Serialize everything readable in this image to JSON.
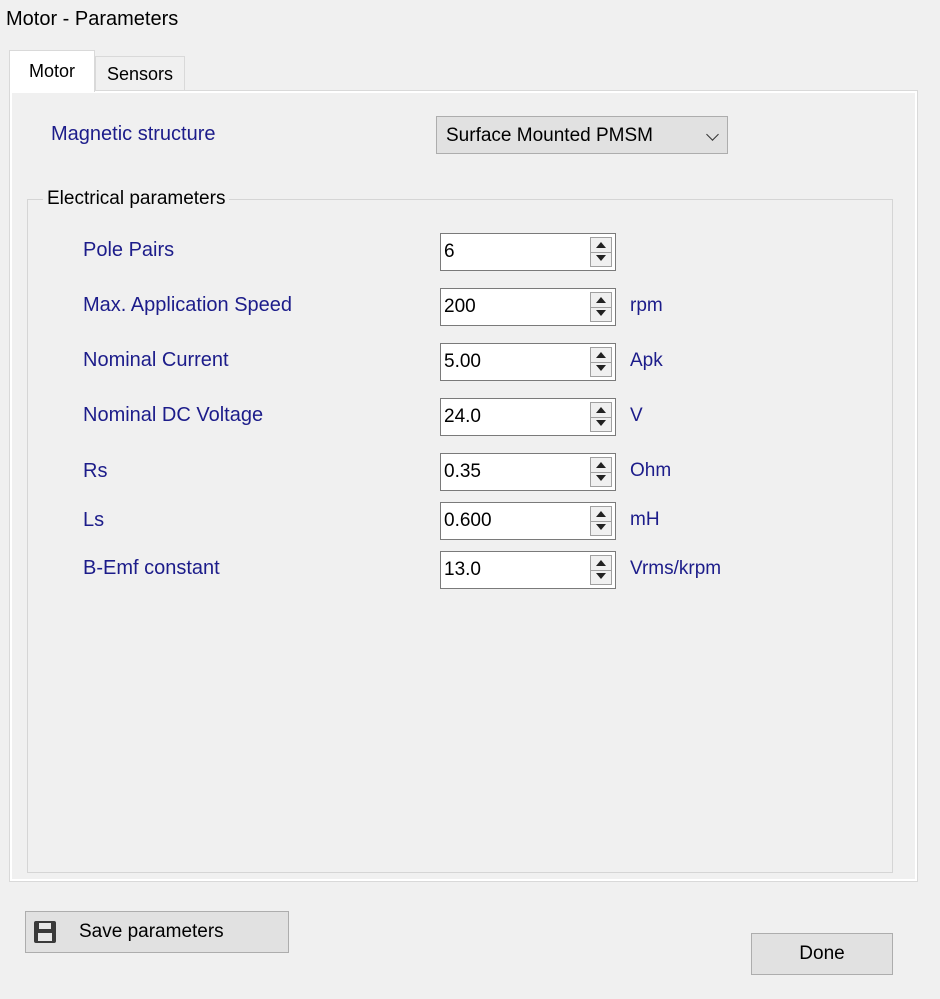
{
  "window": {
    "title": "Motor - Parameters"
  },
  "tabs": [
    {
      "label": "Motor",
      "active": true
    },
    {
      "label": "Sensors",
      "active": false
    }
  ],
  "magnetic_structure": {
    "label": "Magnetic structure",
    "value": "Surface Mounted PMSM"
  },
  "electrical": {
    "legend": "Electrical parameters",
    "params": [
      {
        "label": "Pole Pairs",
        "value": "6",
        "unit": ""
      },
      {
        "label": "Max. Application Speed",
        "value": "200",
        "unit": "rpm"
      },
      {
        "label": "Nominal Current",
        "value": "5.00",
        "unit": "Apk"
      },
      {
        "label": "Nominal DC Voltage",
        "value": "24.0",
        "unit": "V"
      },
      {
        "label": "Rs",
        "value": "0.35",
        "unit": "Ohm"
      },
      {
        "label": "Ls",
        "value": "0.600",
        "unit": "mH"
      },
      {
        "label": "B-Emf constant",
        "value": "13.0",
        "unit": "Vrms/krpm"
      }
    ]
  },
  "buttons": {
    "save_label": "Save parameters",
    "done_label": "Done"
  },
  "icons": {
    "save": "floppy-disk-icon",
    "dropdown": "chevron-down-icon"
  }
}
